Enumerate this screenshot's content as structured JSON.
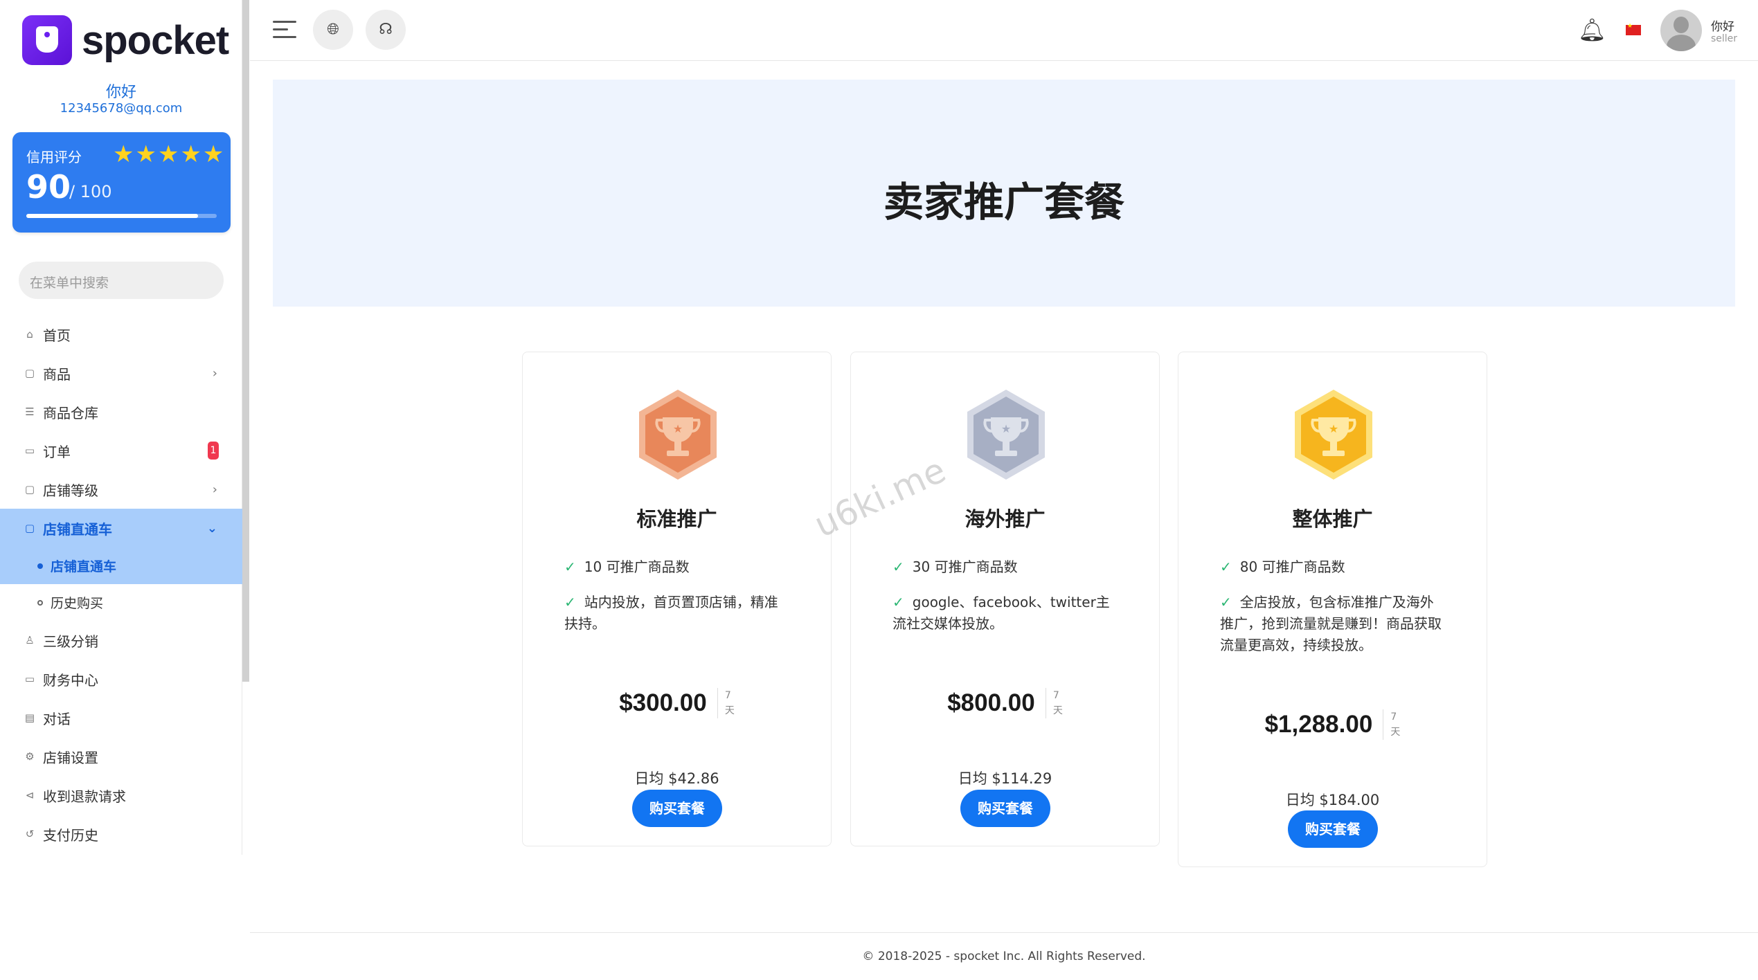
{
  "brand": {
    "name": "spocket"
  },
  "user": {
    "greeting": "你好",
    "email": "12345678@qq.com",
    "name": "你好",
    "role": "seller"
  },
  "credit": {
    "label": "信用评分",
    "score": "90",
    "max": "/ 100",
    "stars": "★★★★★",
    "progress": 0.9
  },
  "search": {
    "placeholder": "在菜单中搜索"
  },
  "menu": {
    "items": [
      {
        "label": "首页",
        "icon": "home-icon"
      },
      {
        "label": "商品",
        "icon": "bag-icon"
      },
      {
        "label": "商品仓库",
        "icon": "warehouse-icon"
      },
      {
        "label": "订单",
        "icon": "order-icon",
        "badge": "1"
      },
      {
        "label": "店铺等级",
        "icon": "level-icon"
      },
      {
        "label": "店铺直通车",
        "icon": "car-icon"
      },
      {
        "label": "三级分销",
        "icon": "user-icon"
      },
      {
        "label": "财务中心",
        "icon": "finance-icon"
      },
      {
        "label": "对话",
        "icon": "chat-icon"
      },
      {
        "label": "店铺设置",
        "icon": "gear-icon"
      },
      {
        "label": "收到退款请求",
        "icon": "refund-icon"
      },
      {
        "label": "支付历史",
        "icon": "history-icon"
      }
    ],
    "sub": [
      "店铺直通车",
      "历史购买"
    ]
  },
  "banner": {
    "title": "卖家推广套餐"
  },
  "plans": [
    {
      "name": "标准推广",
      "features": [
        "10 可推广商品数",
        "站内投放，首页置顶店铺，精准扶持。"
      ],
      "price": "$300.00",
      "period_num": "7",
      "period_unit": "天",
      "daily": "日均 $42.86",
      "buy": "购买套餐"
    },
    {
      "name": "海外推广",
      "features": [
        "30 可推广商品数",
        "google、facebook、twitter主流社交媒体投放。"
      ],
      "price": "$800.00",
      "period_num": "7",
      "period_unit": "天",
      "daily": "日均 $114.29",
      "buy": "购买套餐"
    },
    {
      "name": "整体推广",
      "features": [
        "80 可推广商品数",
        "全店投放，包含标准推广及海外推广，抢到流量就是赚到！商品获取流量更高效，持续投放。"
      ],
      "price": "$1,288.00",
      "period_num": "7",
      "period_unit": "天",
      "daily": "日均 $184.00",
      "buy": "购买套餐"
    }
  ],
  "watermark": "u6ki.me",
  "footer": {
    "text": "© 2018-2025 - spocket Inc. All Rights Reserved."
  },
  "colors": {
    "accent": "#1275f2",
    "active_bg": "#a8cdfb",
    "credit_bg": "#2e7cf0",
    "banner_bg": "#eef4fe",
    "bronze": "#e8875a",
    "silver": "#a7afc4",
    "gold": "#f6b51e"
  }
}
